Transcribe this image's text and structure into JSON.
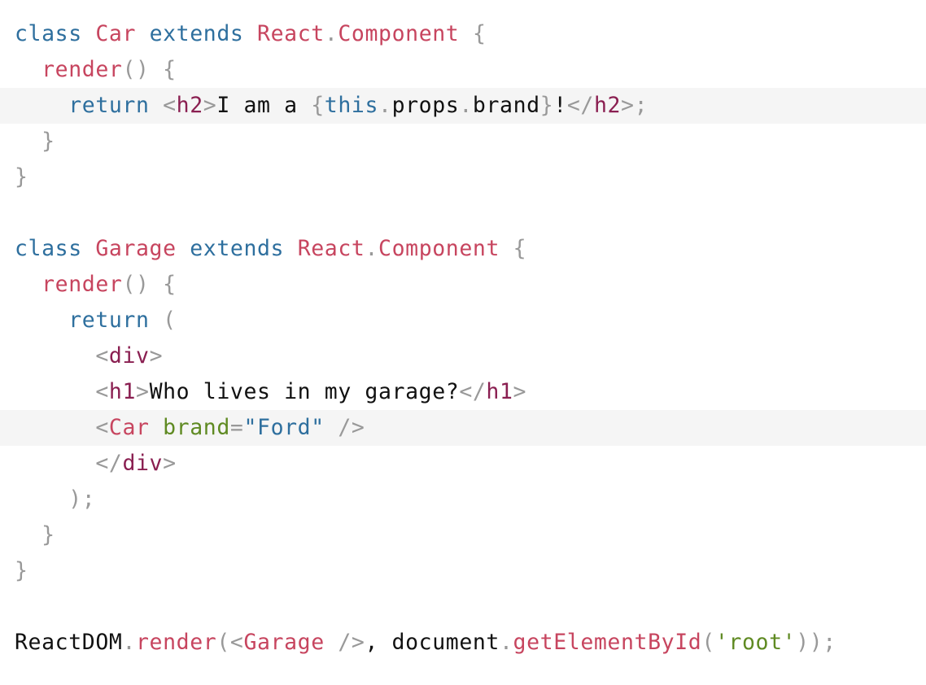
{
  "code": {
    "lines": [
      {
        "highlight": false,
        "tokens": [
          {
            "t": "class",
            "c": "kw"
          },
          {
            "t": " ",
            "c": "text"
          },
          {
            "t": "Car",
            "c": "cls"
          },
          {
            "t": " ",
            "c": "text"
          },
          {
            "t": "extends",
            "c": "kw"
          },
          {
            "t": " ",
            "c": "text"
          },
          {
            "t": "React",
            "c": "cls"
          },
          {
            "t": ".",
            "c": "punct"
          },
          {
            "t": "Component",
            "c": "cls"
          },
          {
            "t": " ",
            "c": "text"
          },
          {
            "t": "{",
            "c": "punct"
          }
        ]
      },
      {
        "highlight": false,
        "tokens": [
          {
            "t": "  ",
            "c": "text"
          },
          {
            "t": "render",
            "c": "fn"
          },
          {
            "t": "()",
            "c": "punct"
          },
          {
            "t": " ",
            "c": "text"
          },
          {
            "t": "{",
            "c": "punct"
          }
        ]
      },
      {
        "highlight": true,
        "tokens": [
          {
            "t": "    ",
            "c": "text"
          },
          {
            "t": "return",
            "c": "kw"
          },
          {
            "t": " ",
            "c": "text"
          },
          {
            "t": "<",
            "c": "punct"
          },
          {
            "t": "h2",
            "c": "tag"
          },
          {
            "t": ">",
            "c": "punct"
          },
          {
            "t": "I am a ",
            "c": "text"
          },
          {
            "t": "{",
            "c": "punct"
          },
          {
            "t": "this",
            "c": "kw"
          },
          {
            "t": ".",
            "c": "punct"
          },
          {
            "t": "props",
            "c": "text"
          },
          {
            "t": ".",
            "c": "punct"
          },
          {
            "t": "brand",
            "c": "text"
          },
          {
            "t": "}",
            "c": "punct"
          },
          {
            "t": "!",
            "c": "text"
          },
          {
            "t": "</",
            "c": "punct"
          },
          {
            "t": "h2",
            "c": "tag"
          },
          {
            "t": ">",
            "c": "punct"
          },
          {
            "t": ";",
            "c": "punct"
          }
        ]
      },
      {
        "highlight": false,
        "tokens": [
          {
            "t": "  ",
            "c": "text"
          },
          {
            "t": "}",
            "c": "punct"
          }
        ]
      },
      {
        "highlight": false,
        "tokens": [
          {
            "t": "}",
            "c": "punct"
          }
        ]
      },
      {
        "highlight": false,
        "tokens": []
      },
      {
        "highlight": false,
        "tokens": [
          {
            "t": "class",
            "c": "kw"
          },
          {
            "t": " ",
            "c": "text"
          },
          {
            "t": "Garage",
            "c": "cls"
          },
          {
            "t": " ",
            "c": "text"
          },
          {
            "t": "extends",
            "c": "kw"
          },
          {
            "t": " ",
            "c": "text"
          },
          {
            "t": "React",
            "c": "cls"
          },
          {
            "t": ".",
            "c": "punct"
          },
          {
            "t": "Component",
            "c": "cls"
          },
          {
            "t": " ",
            "c": "text"
          },
          {
            "t": "{",
            "c": "punct"
          }
        ]
      },
      {
        "highlight": false,
        "tokens": [
          {
            "t": "  ",
            "c": "text"
          },
          {
            "t": "render",
            "c": "fn"
          },
          {
            "t": "()",
            "c": "punct"
          },
          {
            "t": " ",
            "c": "text"
          },
          {
            "t": "{",
            "c": "punct"
          }
        ]
      },
      {
        "highlight": false,
        "tokens": [
          {
            "t": "    ",
            "c": "text"
          },
          {
            "t": "return",
            "c": "kw"
          },
          {
            "t": " ",
            "c": "text"
          },
          {
            "t": "(",
            "c": "punct"
          }
        ]
      },
      {
        "highlight": false,
        "tokens": [
          {
            "t": "      ",
            "c": "text"
          },
          {
            "t": "<",
            "c": "punct"
          },
          {
            "t": "div",
            "c": "tag"
          },
          {
            "t": ">",
            "c": "punct"
          }
        ]
      },
      {
        "highlight": false,
        "tokens": [
          {
            "t": "      ",
            "c": "text"
          },
          {
            "t": "<",
            "c": "punct"
          },
          {
            "t": "h1",
            "c": "tag"
          },
          {
            "t": ">",
            "c": "punct"
          },
          {
            "t": "Who lives in my garage?",
            "c": "text"
          },
          {
            "t": "</",
            "c": "punct"
          },
          {
            "t": "h1",
            "c": "tag"
          },
          {
            "t": ">",
            "c": "punct"
          }
        ]
      },
      {
        "highlight": true,
        "tokens": [
          {
            "t": "      ",
            "c": "text"
          },
          {
            "t": "<",
            "c": "punct"
          },
          {
            "t": "Car",
            "c": "cls"
          },
          {
            "t": " ",
            "c": "text"
          },
          {
            "t": "brand",
            "c": "attr"
          },
          {
            "t": "=",
            "c": "punct"
          },
          {
            "t": "\"Ford\"",
            "c": "str"
          },
          {
            "t": " ",
            "c": "text"
          },
          {
            "t": "/>",
            "c": "punct"
          }
        ]
      },
      {
        "highlight": false,
        "tokens": [
          {
            "t": "      ",
            "c": "text"
          },
          {
            "t": "</",
            "c": "punct"
          },
          {
            "t": "div",
            "c": "tag"
          },
          {
            "t": ">",
            "c": "punct"
          }
        ]
      },
      {
        "highlight": false,
        "tokens": [
          {
            "t": "    ",
            "c": "text"
          },
          {
            "t": ");",
            "c": "punct"
          }
        ]
      },
      {
        "highlight": false,
        "tokens": [
          {
            "t": "  ",
            "c": "text"
          },
          {
            "t": "}",
            "c": "punct"
          }
        ]
      },
      {
        "highlight": false,
        "tokens": [
          {
            "t": "}",
            "c": "punct"
          }
        ]
      },
      {
        "highlight": false,
        "tokens": []
      },
      {
        "highlight": false,
        "tokens": [
          {
            "t": "ReactDOM",
            "c": "text"
          },
          {
            "t": ".",
            "c": "punct"
          },
          {
            "t": "render",
            "c": "fn"
          },
          {
            "t": "(<",
            "c": "punct"
          },
          {
            "t": "Garage",
            "c": "cls"
          },
          {
            "t": " ",
            "c": "text"
          },
          {
            "t": "/>",
            "c": "punct"
          },
          {
            "t": ", ",
            "c": "text"
          },
          {
            "t": "document",
            "c": "text"
          },
          {
            "t": ".",
            "c": "punct"
          },
          {
            "t": "getElementById",
            "c": "fn"
          },
          {
            "t": "(",
            "c": "punct"
          },
          {
            "t": "'root'",
            "c": "str2"
          },
          {
            "t": "));",
            "c": "punct"
          }
        ]
      }
    ]
  }
}
